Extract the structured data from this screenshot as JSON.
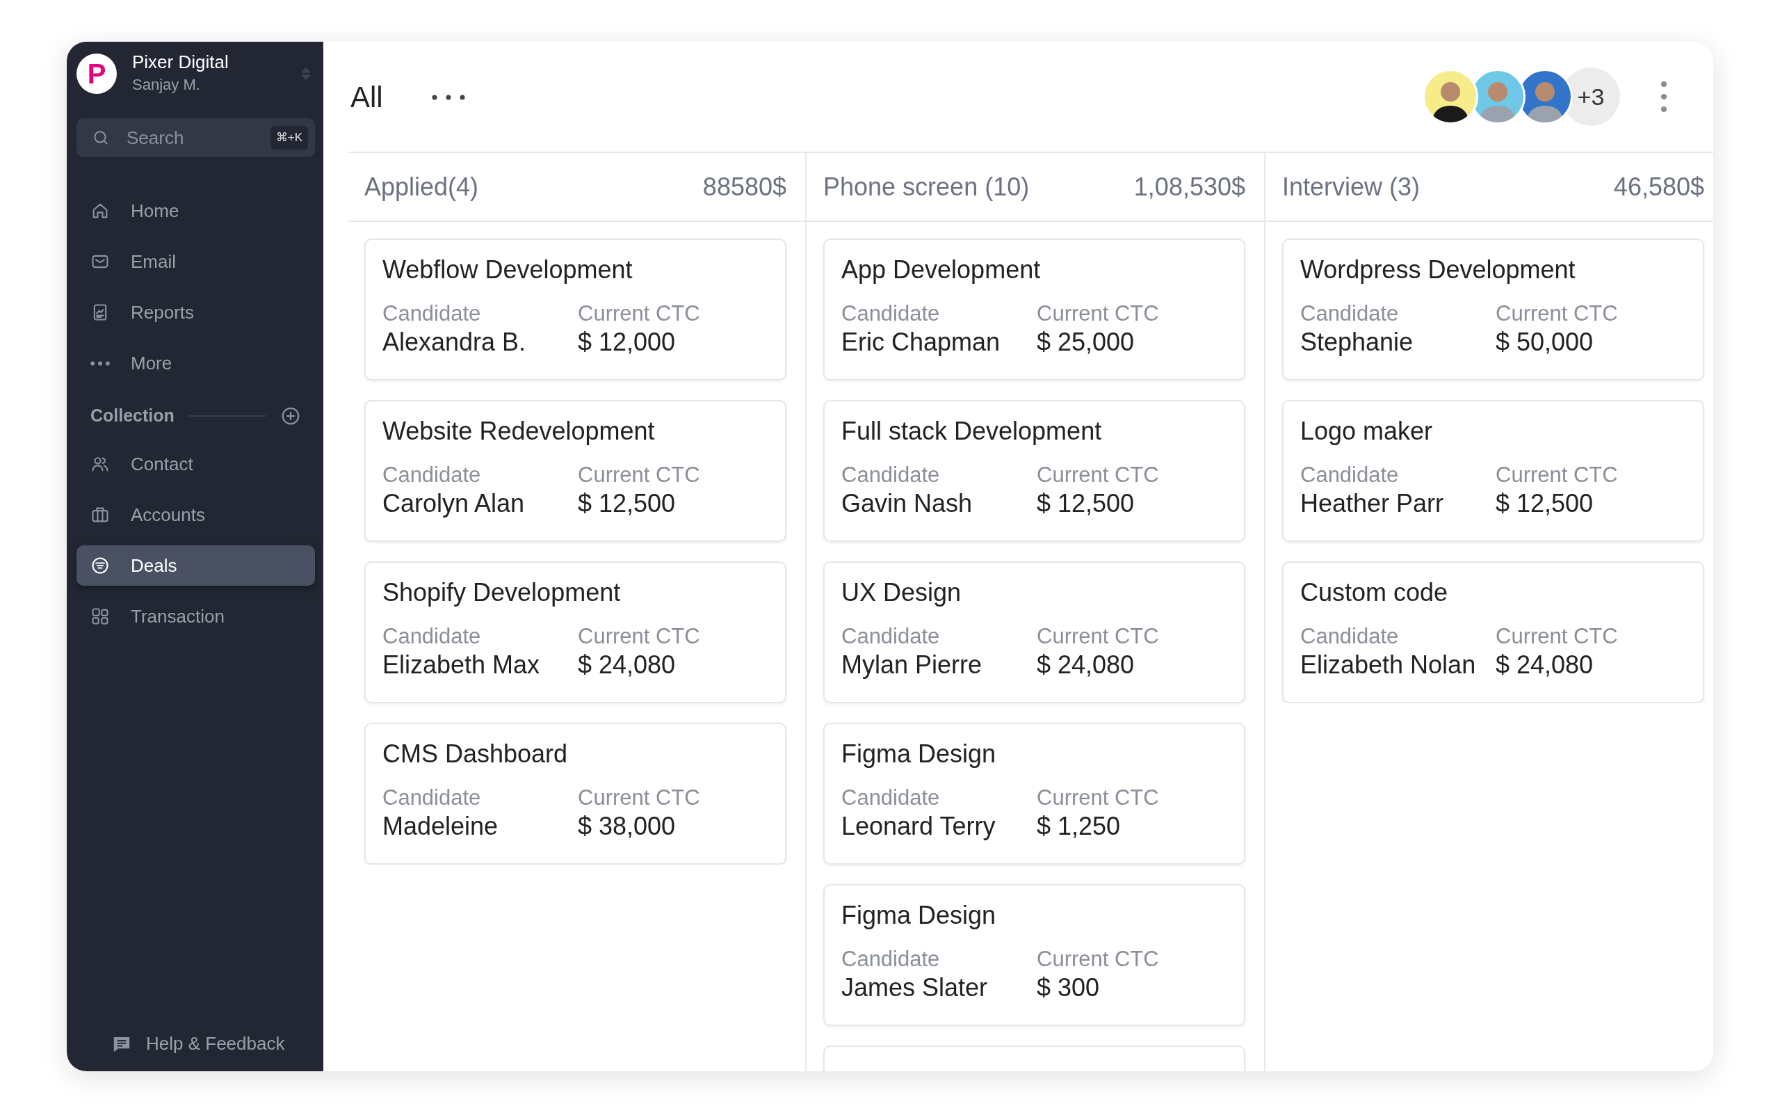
{
  "workspace": {
    "name": "Pixer Digital",
    "user": "Sanjay M.",
    "logo": "P"
  },
  "search": {
    "placeholder": "Search",
    "shortcut": "⌘+K"
  },
  "nav": [
    {
      "label": "Home",
      "selected": false
    },
    {
      "label": "Email",
      "selected": false
    },
    {
      "label": "Reports",
      "selected": false
    },
    {
      "label": "More",
      "selected": false
    }
  ],
  "collection": {
    "title": "Collection",
    "items": [
      {
        "label": "Contact",
        "selected": false
      },
      {
        "label": "Accounts",
        "selected": false
      },
      {
        "label": "Deals",
        "selected": true
      },
      {
        "label": "Transaction",
        "selected": false
      }
    ]
  },
  "help": "Help & Feedback",
  "view": {
    "title": "All"
  },
  "team": {
    "avatars": [
      {
        "color": "#f6ec8a"
      },
      {
        "color": "#6ec8e8"
      },
      {
        "color": "#3274c9"
      }
    ],
    "more": "+3"
  },
  "columns": [
    {
      "title": "Applied(4)",
      "total": "88580$",
      "cards": [
        {
          "title": "Webflow Development",
          "candidate_label": "Candidate",
          "candidate": "Alexandra B.",
          "ctc_label": "Current CTC",
          "ctc": "$ 12,000"
        },
        {
          "title": "Website Redevelopment",
          "candidate_label": "Candidate",
          "candidate": "Carolyn Alan",
          "ctc_label": "Current CTC",
          "ctc": "$ 12,500"
        },
        {
          "title": "Shopify Development",
          "candidate_label": "Candidate",
          "candidate": "Elizabeth Max",
          "ctc_label": "Current CTC",
          "ctc": "$ 24,080"
        },
        {
          "title": "CMS Dashboard",
          "candidate_label": "Candidate",
          "candidate": "Madeleine",
          "ctc_label": "Current CTC",
          "ctc": "$ 38,000"
        }
      ]
    },
    {
      "title": "Phone screen (10)",
      "total": "1,08,530$",
      "cards": [
        {
          "title": "App Development",
          "candidate_label": "Candidate",
          "candidate": "Eric Chapman",
          "ctc_label": "Current CTC",
          "ctc": "$ 25,000"
        },
        {
          "title": "Full stack Development",
          "candidate_label": "Candidate",
          "candidate": "Gavin Nash",
          "ctc_label": "Current CTC",
          "ctc": "$ 12,500"
        },
        {
          "title": "UX Design",
          "candidate_label": "Candidate",
          "candidate": "Mylan Pierre",
          "ctc_label": "Current CTC",
          "ctc": "$ 24,080"
        },
        {
          "title": "Figma Design",
          "candidate_label": "Candidate",
          "candidate": "Leonard Terry",
          "ctc_label": "Current CTC",
          "ctc": "$ 1,250"
        },
        {
          "title": "Figma Design",
          "candidate_label": "Candidate",
          "candidate": "James Slater",
          "ctc_label": "Current CTC",
          "ctc": "$ 300"
        }
      ],
      "more_below": true
    },
    {
      "title": "Interview (3)",
      "total": "46,580$",
      "cards": [
        {
          "title": "Wordpress Development",
          "candidate_label": "Candidate",
          "candidate": "Stephanie",
          "ctc_label": "Current CTC",
          "ctc": "$ 50,000"
        },
        {
          "title": "Logo maker",
          "candidate_label": "Candidate",
          "candidate": "Heather Parr",
          "ctc_label": "Current CTC",
          "ctc": "$ 12,500"
        },
        {
          "title": "Custom code",
          "candidate_label": "Candidate",
          "candidate": "Elizabeth Nolan",
          "ctc_label": "Current CTC",
          "ctc": "$ 24,080"
        }
      ]
    }
  ]
}
